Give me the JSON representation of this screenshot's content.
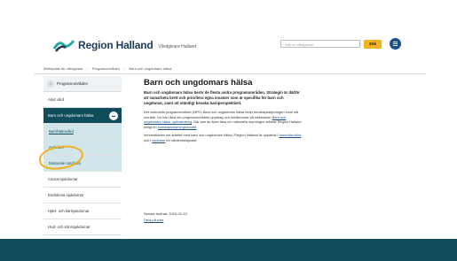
{
  "header": {
    "logo_text": "Region Halland",
    "logo_sub": "Vårdgivare Halland",
    "search_placeholder": "Sök en vårdgivare",
    "search_button": "Sök"
  },
  "breadcrumbs": [
    "Webbplats för vårdgivare",
    "Programområden",
    "Barn och ungdomars hälsa"
  ],
  "sidebar": {
    "head": "Programområden",
    "items": [
      {
        "label": "Akut vård"
      },
      {
        "label": "Barn och ungdomars hälsa"
      },
      {
        "label": "Barnhälsovård"
      },
      {
        "label": "Avdelare"
      },
      {
        "label": "Nationale områden"
      },
      {
        "label": "Cancersjukdomar"
      },
      {
        "label": "Endokrina sjukdomar"
      },
      {
        "label": "Hjärt- och kärlsjukdomar"
      },
      {
        "label": "Hud- och könssjukdomar"
      }
    ]
  },
  "main": {
    "title": "Barn och ungdomars hälsa",
    "lead": "Barn och ungdomars hälsa berör de flesta andra programområden. Strategin är därför att samarbeta brett och prioritera egna insatser som är specifika för barn och ungdomar, samt att ständigt bevaka barnperspektivet.",
    "para1": "Det nationella programområdet (NPO) Barn och ungdomars hälsa leder kunskapsstyrningen inom sitt område. Du kan läsa om programområdets uppdrag och medlemmar på webbsidan",
    "para1_link": "Barn och ungdomars hälsa, sjukvardsreg",
    "para1_end": ". Där kan du även läsa om nationella styrningen arbetar Region Halland enligt en",
    "para1_link2": "kunskapsstyrningsmodell",
    "para2": "Informationen om arbetet med barn och ungdomars hälsa i Region Halland är uppdelat i",
    "para2_link": "barnhälsovård",
    "para2_mid": "och i",
    "para2_link2": "avdelare",
    "para2_end": "för vårdenhetsjustet.",
    "updated": "Senast ändrad: 2024-02-22",
    "share": "Dela på sida"
  }
}
